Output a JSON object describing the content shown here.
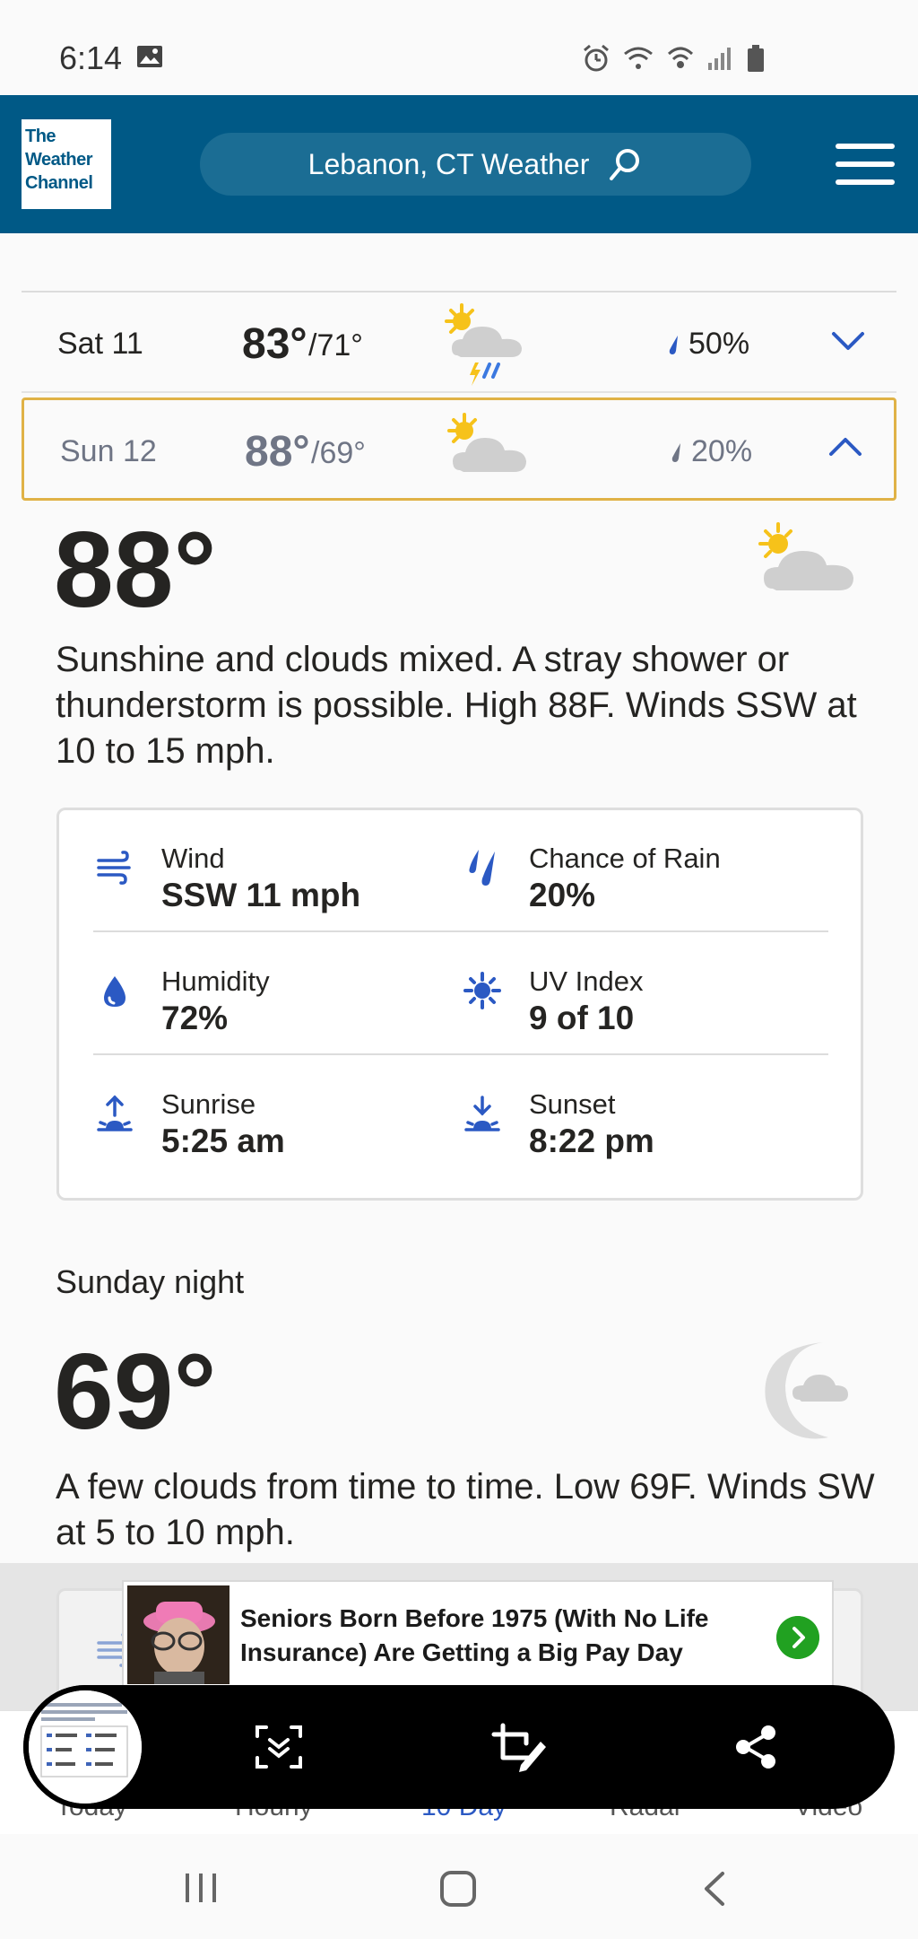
{
  "status_bar": {
    "time": "6:14"
  },
  "header": {
    "logo_lines": [
      "The",
      "Weather",
      "Channel"
    ],
    "search_label": "Lebanon, CT Weather"
  },
  "days": [
    {
      "day": "Sat 11",
      "high": "83°",
      "low": "/71°",
      "precip": "50%",
      "condition_icon": "scattered-thunderstorms-icon",
      "expanded": false
    },
    {
      "day": "Sun 12",
      "high": "88°",
      "low": "/69°",
      "precip": "20%",
      "condition_icon": "partly-cloudy-icon",
      "expanded": true
    }
  ],
  "day_detail": {
    "temp": "88°",
    "narrative": "Sunshine and clouds mixed. A stray shower or thunderstorm is possible. High 88F. Winds SSW at 10 to 15 mph.",
    "wind_label": "Wind",
    "wind_value": "SSW 11 mph",
    "rain_label": "Chance of Rain",
    "rain_value": "20%",
    "humidity_label": "Humidity",
    "humidity_value": "72%",
    "uv_label": "UV Index",
    "uv_value": "9 of 10",
    "sunrise_label": "Sunrise",
    "sunrise_value": "5:25 am",
    "sunset_label": "Sunset",
    "sunset_value": "8:22 pm"
  },
  "night": {
    "title": "Sunday night",
    "temp": "69°",
    "narrative": "A few clouds from time to time. Low 69F. Winds SW at 5 to 10 mph."
  },
  "ad": {
    "headline": "Seniors Born Before 1975 (With No Life Insurance) Are Getting a Big Pay Day"
  },
  "bottom_nav": [
    "Today",
    "Hourly",
    "10 Day",
    "Radar",
    "Video"
  ],
  "colors": {
    "brand": "#005986",
    "accent": "#2b59c3",
    "highlight": "#e0b246"
  }
}
